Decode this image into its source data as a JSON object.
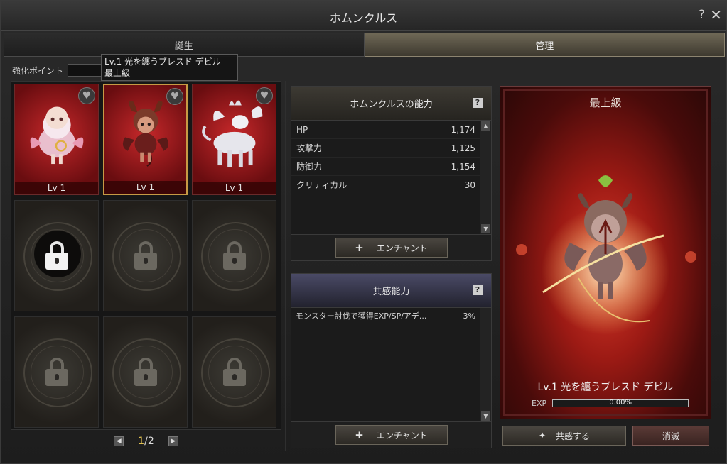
{
  "window": {
    "title": "ホムンクルス"
  },
  "tabs": [
    {
      "label": "誕生",
      "active": false
    },
    {
      "label": "管理",
      "active": true
    }
  ],
  "enhance": {
    "label": "強化ポイント",
    "value": ""
  },
  "tooltip": {
    "line1": "Lv.1 光を纏うブレスド デビル",
    "line2": "最上級"
  },
  "slots": [
    {
      "level": "Lv 1",
      "creature": "cherub-homunculus",
      "state": "filled"
    },
    {
      "level": "Lv 1",
      "creature": "devil-homunculus",
      "state": "selected"
    },
    {
      "level": "Lv 1",
      "creature": "unicorn-homunculus",
      "state": "filled"
    },
    {
      "state": "locked-active"
    },
    {
      "state": "locked"
    },
    {
      "state": "locked"
    },
    {
      "state": "locked"
    },
    {
      "state": "locked"
    },
    {
      "state": "locked"
    }
  ],
  "pager": {
    "current": "1",
    "total": "/2"
  },
  "abilities": {
    "title": "ホムンクルスの能力",
    "stats": [
      {
        "name": "HP",
        "value": "1,174"
      },
      {
        "name": "攻撃力",
        "value": "1,125"
      },
      {
        "name": "防御力",
        "value": "1,154"
      },
      {
        "name": "クリティカル",
        "value": "30"
      }
    ],
    "enchant_label": "エンチャント"
  },
  "sympathy": {
    "title": "共感能力",
    "rows": [
      {
        "name": "モンスター討伐で獲得EXP/SP/アデ...",
        "value": "3%"
      }
    ],
    "enchant_label": "エンチャント"
  },
  "preview": {
    "grade": "最上級",
    "name": "Lv.1 光を纏うブレスド デビル",
    "exp_label": "EXP",
    "exp_value": "0.00%",
    "exp_fraction": 0.0
  },
  "buttons": {
    "resonate": "共感する",
    "destroy": "消滅"
  },
  "colors": {
    "accent_gold": "#c79a45",
    "slot_red": "#c6282a",
    "exp_bar": "#d4b040"
  }
}
